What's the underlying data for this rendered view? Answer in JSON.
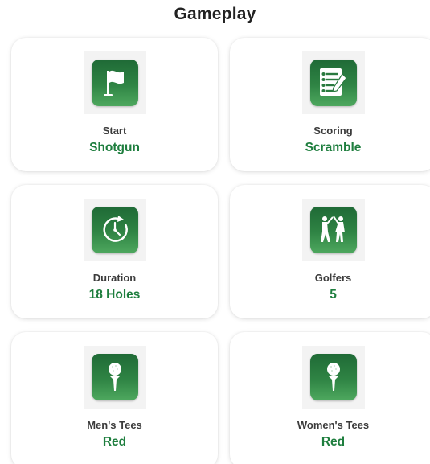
{
  "section": {
    "title": "Gameplay"
  },
  "cards": [
    {
      "label": "Start",
      "value": "Shotgun",
      "icon": "flag-icon"
    },
    {
      "label": "Scoring",
      "value": "Scramble",
      "icon": "scorecard-pencil-icon"
    },
    {
      "label": "Duration",
      "value": "18 Holes",
      "icon": "clock-icon"
    },
    {
      "label": "Golfers",
      "value": "5",
      "icon": "golfers-icon"
    },
    {
      "label": "Men's Tees",
      "value": "Red",
      "icon": "golf-ball-tee-icon"
    },
    {
      "label": "Women's Tees",
      "value": "Red",
      "icon": "golf-ball-tee-icon"
    }
  ],
  "colors": {
    "accent": "#1e7e3e",
    "icon_tile_top": "#1f6a36",
    "icon_tile_bottom": "#4ea85e",
    "label_text": "#3b3b3b",
    "title_text": "#222222"
  }
}
